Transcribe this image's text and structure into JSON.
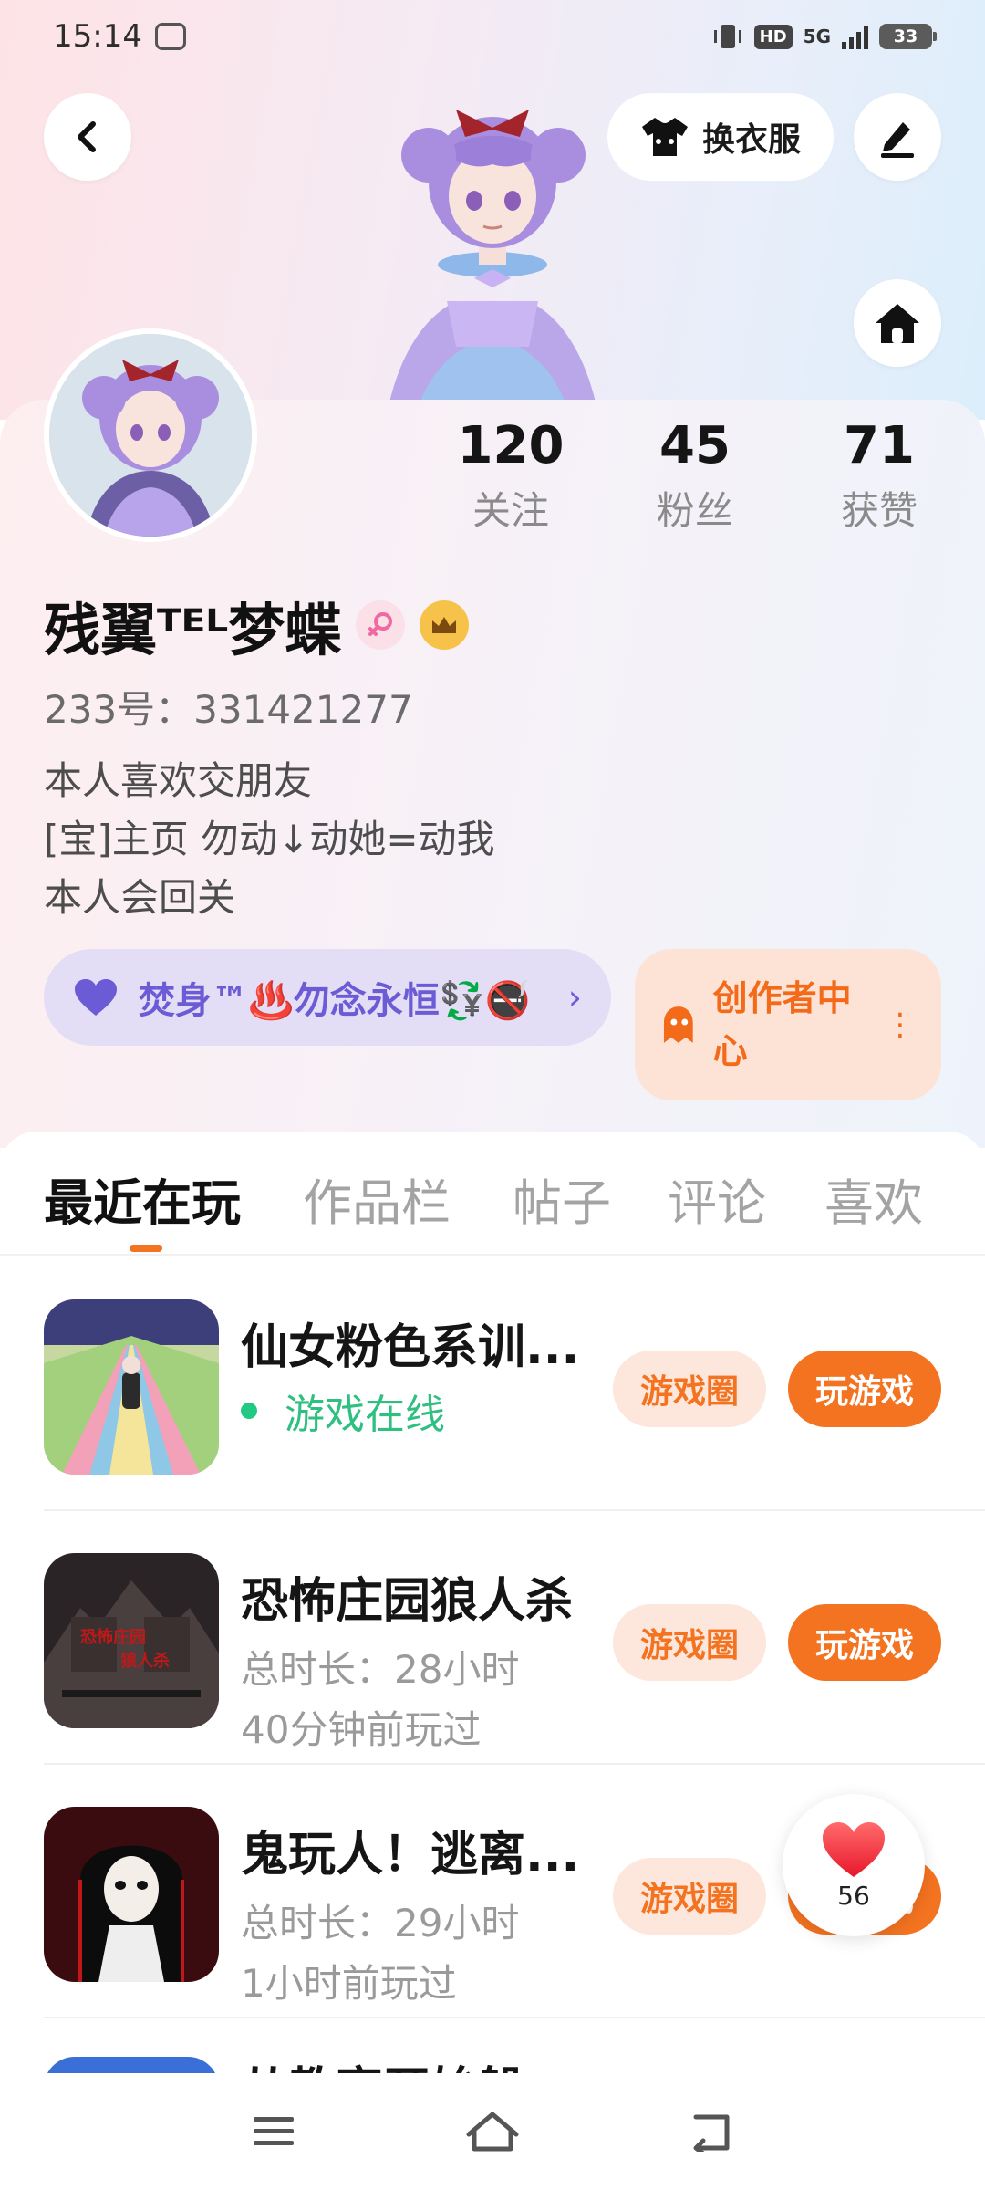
{
  "status_bar": {
    "time": "15:14",
    "hd": "HD",
    "network": "5G",
    "battery": "33"
  },
  "header": {
    "back_icon": "chevron-left-icon",
    "dress_label": "换衣服",
    "edit_icon": "pen-icon",
    "home_icon": "house-icon"
  },
  "stats": [
    {
      "value": "120",
      "label": "关注"
    },
    {
      "value": "45",
      "label": "粉丝"
    },
    {
      "value": "71",
      "label": "获赞"
    }
  ],
  "profile": {
    "nickname": "残翼ᵀᴱᴸ梦蝶",
    "uid_label": "233号：331421277",
    "bio": [
      "本人喜欢交朋友",
      "[宝]主页 勿动↓动她=动我",
      "本人会回关"
    ]
  },
  "group_pill": {
    "name": "焚身™♨️勿念永恒💱🚭",
    "chevron": "›"
  },
  "creator_center": {
    "label": "创作者中心",
    "more": "⋮"
  },
  "tabs": [
    "最近在玩",
    "作品栏",
    "帖子",
    "评论",
    "喜欢"
  ],
  "games": [
    {
      "title": "仙女粉色系训...",
      "status": "游戏在线",
      "circle_label": "游戏圈",
      "play_label": "玩游戏"
    },
    {
      "title": "恐怖庄园狼人杀",
      "duration": "总时长：28小时",
      "last_played": "40分钟前玩过",
      "circle_label": "游戏圈",
      "play_label": "玩游戏"
    },
    {
      "title": "鬼玩人！逃离...",
      "duration": "总时长：29小时",
      "last_played": "1小时前玩过",
      "circle_label": "游戏圈",
      "play_label": "玩游戏"
    },
    {
      "title": "从教室开始躲"
    }
  ],
  "like_fab": {
    "count": "56"
  },
  "colors": {
    "accent": "#f47321",
    "accent_light": "#fde6db",
    "online_green": "#22c985",
    "group_purple": "#6b5cd6"
  }
}
